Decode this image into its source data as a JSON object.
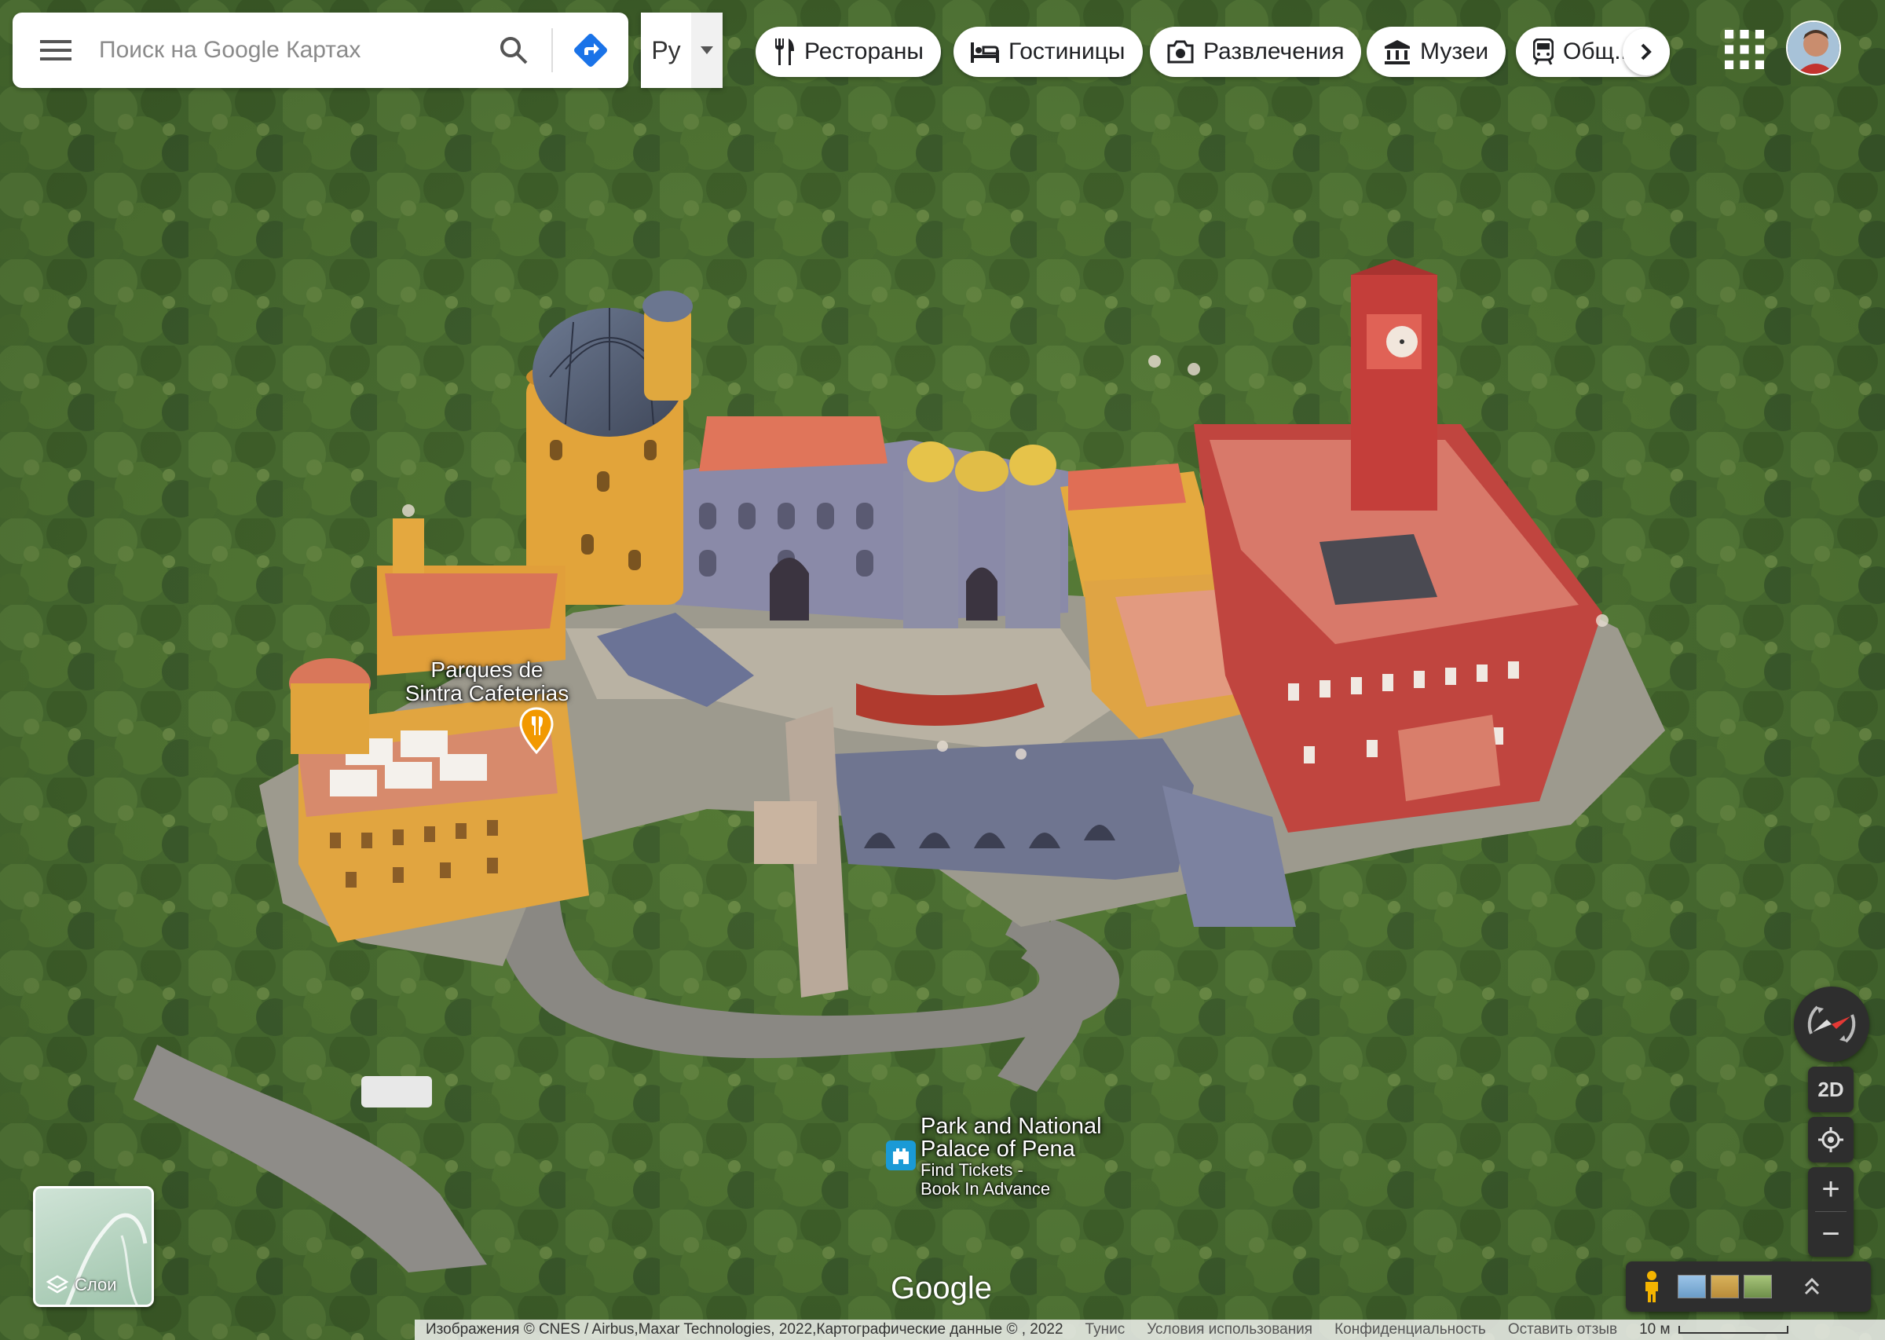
{
  "search": {
    "placeholder": "Поиск на Google Картах"
  },
  "language": {
    "label": "Ру"
  },
  "categories": [
    {
      "label": "Рестораны",
      "icon": "restaurant-icon"
    },
    {
      "label": "Гостиницы",
      "icon": "hotel-icon"
    },
    {
      "label": "Развлечения",
      "icon": "camera-icon"
    },
    {
      "label": "Музеи",
      "icon": "museum-icon"
    },
    {
      "label": "Общ...",
      "icon": "transit-icon"
    }
  ],
  "map": {
    "pois": [
      {
        "name": "Parques de Sintra Cafeterias",
        "line1": "Parques de",
        "line2": "Sintra Cafeterias",
        "type": "restaurant",
        "pin_color": "#f29900"
      },
      {
        "name": "Park and National Palace of Pena",
        "line1": "Park and National",
        "line2": "Palace of Pena",
        "sub1": "Find Tickets -",
        "sub2": "Book In Advance",
        "type": "museum",
        "pin_color": "#1a9ad6"
      }
    ],
    "logo": "Google"
  },
  "layers": {
    "label": "Слои"
  },
  "controls": {
    "mode_2d": "2D",
    "zoom_in": "+",
    "zoom_out": "−"
  },
  "footer": {
    "attribution": "Изображения © CNES / Airbus,Maxar Technologies, 2022,Картографические данные © , 2022",
    "region": "Тунис",
    "terms": "Условия использования",
    "privacy": "Конфиденциальность",
    "feedback": "Оставить отзыв",
    "scale": "10 м"
  }
}
